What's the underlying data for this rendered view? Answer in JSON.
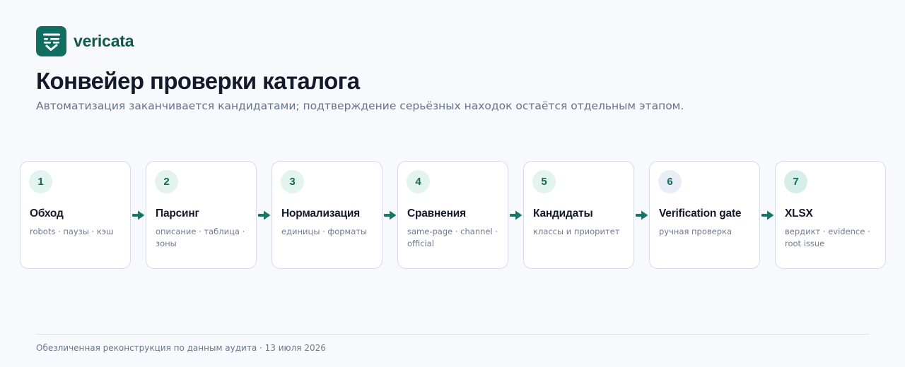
{
  "brand": {
    "name": "vericata",
    "logo_icon": "checklist-icon",
    "color": "#0f6e5f"
  },
  "page": {
    "title": "Конвейер проверки каталога",
    "subtitle": "Автоматизация заканчивается кандидатами; подтверждение серьёзных находок остаётся отдельным этапом."
  },
  "pipeline": {
    "connector_icon": "arrow-right-icon",
    "stages": [
      {
        "number": "1",
        "title": "Обход",
        "description": "robots · паузы · кэш",
        "badge_color": "#e3f3ee"
      },
      {
        "number": "2",
        "title": "Парсинг",
        "description": "описание · таблица · зоны",
        "badge_color": "#e3f3ee"
      },
      {
        "number": "3",
        "title": "Нормализация",
        "description": "единицы · форматы",
        "badge_color": "#e3f3ee"
      },
      {
        "number": "4",
        "title": "Сравнения",
        "description": "same-page · channel · official",
        "badge_color": "#e3f3ee"
      },
      {
        "number": "5",
        "title": "Кандидаты",
        "description": "классы и приоритет",
        "badge_color": "#e3f3ee"
      },
      {
        "number": "6",
        "title": "Verification gate",
        "description": "ручная проверка",
        "badge_color": "#e7eef6"
      },
      {
        "number": "7",
        "title": "XLSX",
        "description": "вердикт · evidence · root issue",
        "badge_color": "#d7ede7"
      }
    ]
  },
  "footer": {
    "text": "Обезличенная реконструкция по данным аудита · 13 июля 2026"
  }
}
